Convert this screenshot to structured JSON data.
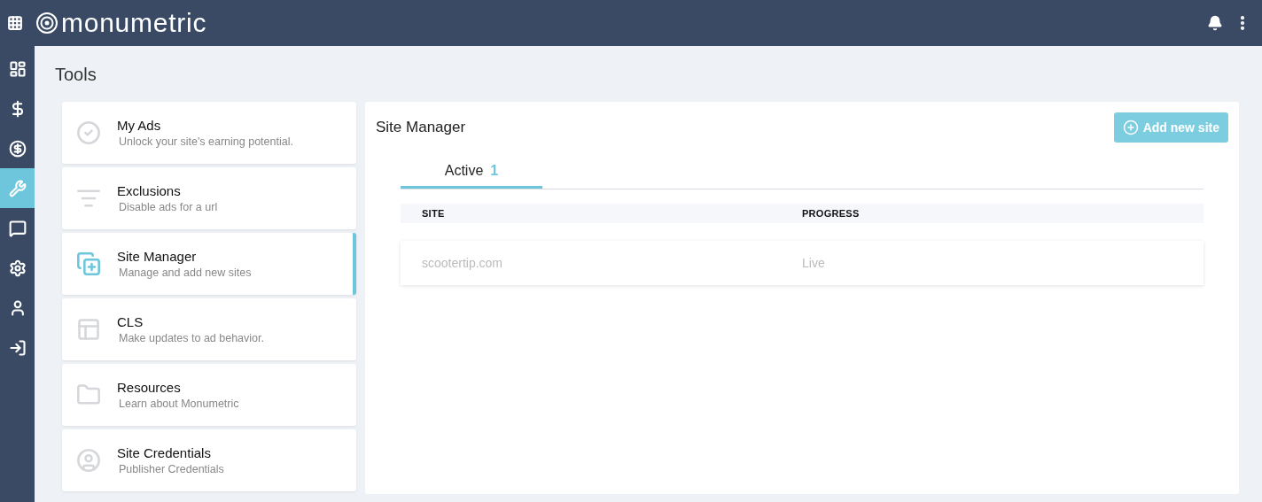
{
  "header": {
    "logo": "monumetric"
  },
  "nav": [
    {
      "kind": "dashboard",
      "selected": false
    },
    {
      "kind": "dollar",
      "selected": false
    },
    {
      "kind": "dollar-circle",
      "selected": false
    },
    {
      "kind": "wrench",
      "selected": true
    },
    {
      "kind": "message",
      "selected": false
    },
    {
      "kind": "gear",
      "selected": false
    },
    {
      "kind": "person",
      "selected": false
    },
    {
      "kind": "sign-in",
      "selected": false
    }
  ],
  "page_title": "Tools",
  "tools": [
    {
      "kind": "check",
      "title": "My Ads",
      "subtitle": "Unlock your site's earning potential.",
      "selected": false
    },
    {
      "kind": "filter",
      "title": "Exclusions",
      "subtitle": "Disable ads for a url",
      "selected": false
    },
    {
      "kind": "add-stack",
      "title": "Site Manager",
      "subtitle": "Manage and add new sites",
      "selected": true
    },
    {
      "kind": "layout",
      "title": "CLS",
      "subtitle": "Make updates to ad behavior.",
      "selected": false
    },
    {
      "kind": "folder",
      "title": "Resources",
      "subtitle": "Learn about Monumetric",
      "selected": false
    },
    {
      "kind": "person",
      "title": "Site Credentials",
      "subtitle": "Publisher Credentials",
      "selected": false
    }
  ],
  "panel": {
    "title": "Site Manager",
    "add_button": "Add new site",
    "tabs": [
      {
        "label": "Active",
        "count": "1",
        "selected": true
      }
    ],
    "table": {
      "columns": [
        "SITE",
        "PROGRESS"
      ],
      "rows": [
        {
          "site": "scootertip.com",
          "progress": "Live"
        }
      ]
    }
  }
}
